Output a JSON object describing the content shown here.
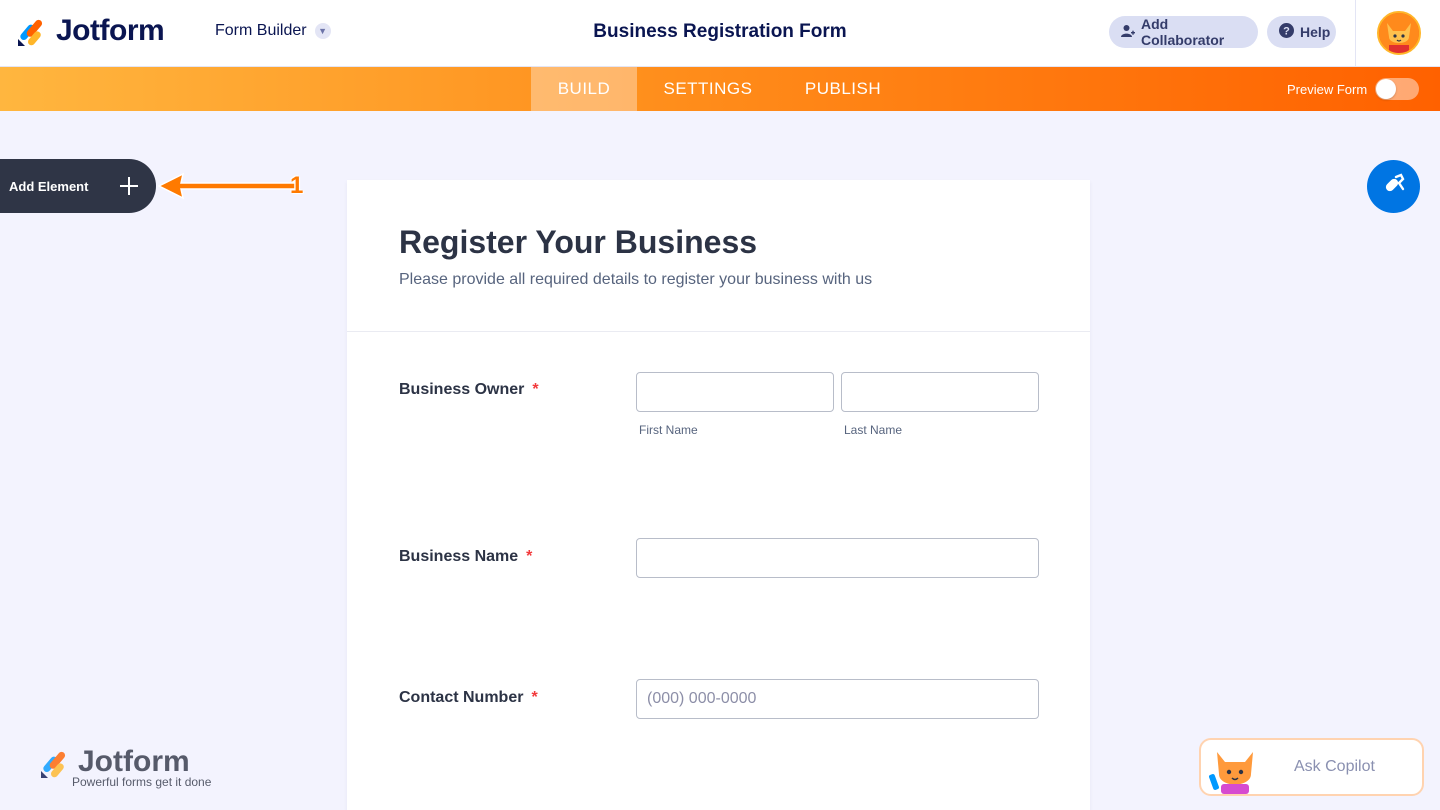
{
  "header": {
    "logo_text": "Jotform",
    "builder_label": "Form Builder",
    "form_title": "Business Registration Form",
    "add_collaborator": "Add Collaborator",
    "help": "Help"
  },
  "nav": {
    "tabs": [
      {
        "label": "BUILD",
        "active": true
      },
      {
        "label": "SETTINGS",
        "active": false
      },
      {
        "label": "PUBLISH",
        "active": false
      }
    ],
    "preview_label": "Preview Form",
    "preview_on": false
  },
  "sidebar": {
    "add_element": "Add Element",
    "annotation_number": "1"
  },
  "form": {
    "heading": "Register Your Business",
    "subheading": "Please provide all required details to register your business with us",
    "fields": [
      {
        "label": "Business Owner",
        "required_mark": "*",
        "sublabels": [
          "First Name",
          "Last Name"
        ]
      },
      {
        "label": "Business Name",
        "required_mark": "*"
      },
      {
        "label": "Contact Number",
        "required_mark": "*",
        "placeholder": "(000) 000-0000"
      }
    ]
  },
  "footer": {
    "logo_text": "Jotform",
    "tagline": "Powerful forms get it done"
  },
  "copilot": {
    "label": "Ask Copilot"
  },
  "colors": {
    "nav_gradient_start": "#ffb63f",
    "nav_gradient_end": "#ff6100",
    "navy": "#0a1551",
    "designer_blue": "#0075e3",
    "required_red": "#f23a3c"
  }
}
